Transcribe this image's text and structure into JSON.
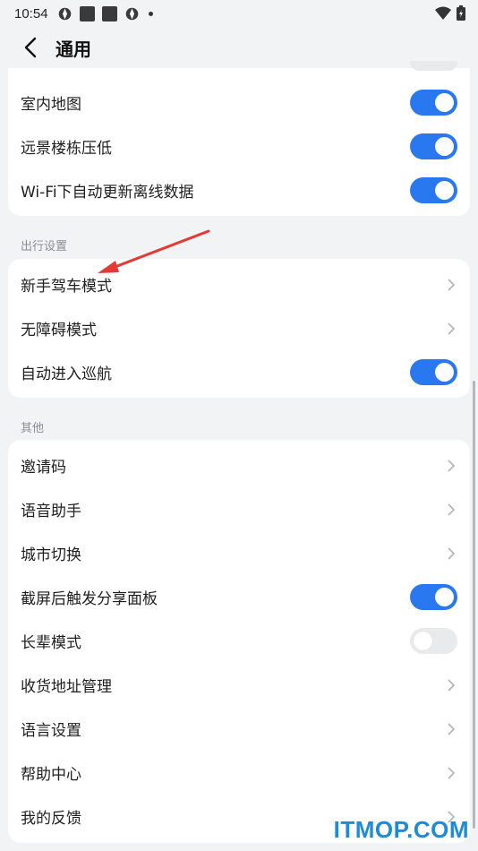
{
  "status_bar": {
    "time": "10:54"
  },
  "header": {
    "title": "通用"
  },
  "card1": {
    "rows": [
      {
        "label": "室内地图",
        "toggle": "on"
      },
      {
        "label": "远景楼栋压低",
        "toggle": "on"
      },
      {
        "label": "Wi-Fi下自动更新离线数据",
        "toggle": "on"
      }
    ]
  },
  "section_travel": {
    "title": "出行设置"
  },
  "card2": {
    "rows": [
      {
        "label": "新手驾车模式"
      },
      {
        "label": "无障碍模式"
      },
      {
        "label": "自动进入巡航",
        "toggle": "on"
      }
    ]
  },
  "section_other": {
    "title": "其他"
  },
  "card3": {
    "rows": [
      {
        "label": "邀请码"
      },
      {
        "label": "语音助手"
      },
      {
        "label": "城市切换"
      },
      {
        "label": "截屏后触发分享面板",
        "toggle": "on"
      },
      {
        "label": "长辈模式",
        "toggle": "off"
      },
      {
        "label": "收货地址管理"
      },
      {
        "label": "语言设置"
      },
      {
        "label": "帮助中心"
      },
      {
        "label": "我的反馈"
      }
    ]
  },
  "watermark": {
    "text": "ITMOP.COM"
  },
  "colors": {
    "accent": "#2a78f0",
    "toggle_off": "#e9eaec",
    "watermark": "#1d8bd6",
    "annotation": "#e53935"
  }
}
